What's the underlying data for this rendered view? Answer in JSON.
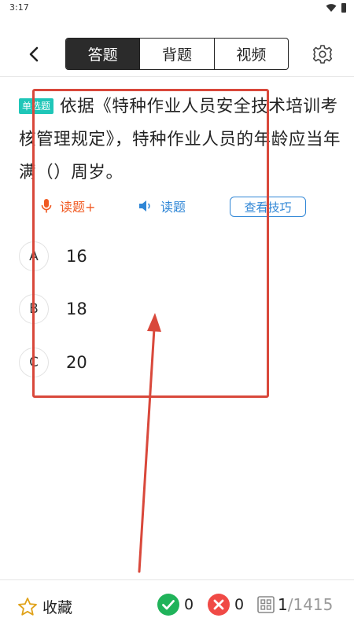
{
  "status_bar": {
    "time": "3:17"
  },
  "nav": {
    "tabs": [
      {
        "label": "答题",
        "active": true
      },
      {
        "label": "背题",
        "active": false
      },
      {
        "label": "视频",
        "active": false
      }
    ]
  },
  "question": {
    "type_badge": "单选题",
    "text": "依据《特种作业人员安全技术培训考核管理规定》，特种作业人员的年龄应当年满（）周岁。"
  },
  "tools": {
    "read_plus_label": "读题+",
    "read_label": "读题",
    "tips_label": "查看技巧"
  },
  "options": [
    {
      "letter": "A",
      "text": "16"
    },
    {
      "letter": "B",
      "text": "18"
    },
    {
      "letter": "C",
      "text": "20"
    }
  ],
  "bottom": {
    "favorite_label": "收藏",
    "correct_count": "0",
    "wrong_count": "0",
    "current": "1",
    "total": "/1415"
  },
  "colors": {
    "badge": "#1fc6b8",
    "read_plus": "#f05a22",
    "read": "#2f86d6",
    "correct": "#20b35a",
    "wrong": "#f04a46",
    "annotation": "#d9483b"
  },
  "icons": [
    "back-icon",
    "settings-icon",
    "mic-icon",
    "speaker-icon",
    "star-icon",
    "check-icon",
    "cross-icon",
    "grid-icon"
  ]
}
